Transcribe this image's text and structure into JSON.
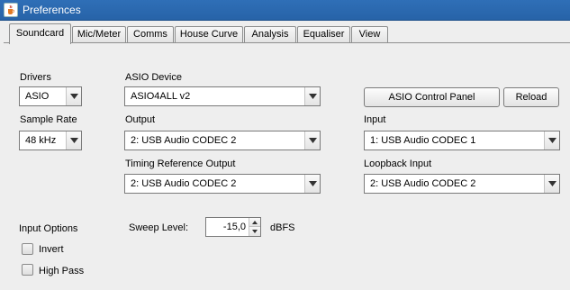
{
  "window": {
    "title": "Preferences",
    "icon": "java-cup-icon"
  },
  "tabs": [
    {
      "label": "Soundcard",
      "active": true
    },
    {
      "label": "Mic/Meter"
    },
    {
      "label": "Comms"
    },
    {
      "label": "House Curve"
    },
    {
      "label": "Analysis"
    },
    {
      "label": "Equaliser"
    },
    {
      "label": "View"
    }
  ],
  "soundcard": {
    "drivers": {
      "label": "Drivers",
      "value": "ASIO"
    },
    "sample_rate": {
      "label": "Sample Rate",
      "value": "48 kHz"
    },
    "asio_device": {
      "label": "ASIO Device",
      "value": "ASIO4ALL v2"
    },
    "asio_control_panel_label": "ASIO Control Panel",
    "reload_label": "Reload",
    "output": {
      "label": "Output",
      "value": "2: USB Audio CODEC  2"
    },
    "input": {
      "label": "Input",
      "value": "1: USB Audio CODEC  1"
    },
    "timing_reference_output": {
      "label": "Timing Reference Output",
      "value": "2: USB Audio CODEC  2"
    },
    "loopback_input": {
      "label": "Loopback Input",
      "value": "2: USB Audio CODEC  2"
    },
    "input_options": {
      "label": "Input Options",
      "invert": {
        "label": "Invert",
        "checked": false
      },
      "high_pass": {
        "label": "High Pass",
        "checked": false
      }
    },
    "sweep_level": {
      "label": "Sweep Level:",
      "value": "-15,0",
      "unit": "dBFS"
    }
  }
}
